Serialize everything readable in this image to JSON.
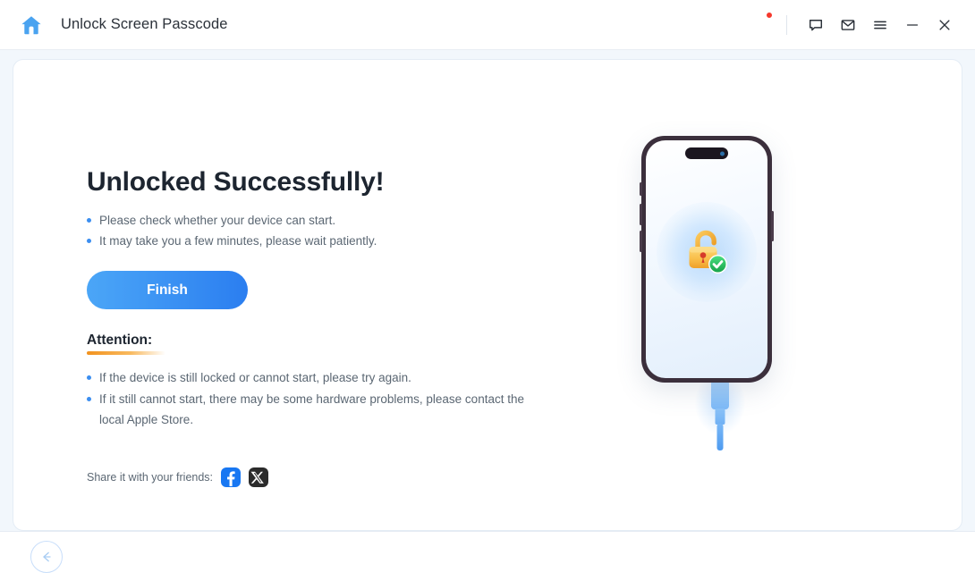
{
  "titlebar": {
    "home_icon": "home-icon",
    "title": "Unlock Screen Passcode",
    "icons": {
      "avatar": "user-avatar-icon",
      "feedback": "chat-bubble-icon",
      "mail": "envelope-icon",
      "menu": "hamburger-menu-icon",
      "minimize": "minimize-icon",
      "close": "close-icon"
    }
  },
  "main": {
    "headline": "Unlocked Successfully!",
    "notes": [
      "Please check whether your device can start.",
      "It may take you a few minutes, please wait patiently."
    ],
    "finish_label": "Finish",
    "attention": {
      "title": "Attention:",
      "items": [
        "If the device is still locked or cannot start, please try again.",
        "If it still cannot start, there may be some hardware problems, please contact the local Apple Store."
      ]
    },
    "share": {
      "label": "Share it with your friends:",
      "facebook": "facebook-icon",
      "x": "x-twitter-icon"
    },
    "illustration": {
      "device": "iphone-device",
      "status_icon": "unlocked-padlock-with-check-icon",
      "cable": "lightning-cable-icon"
    }
  },
  "bottombar": {
    "back_icon": "arrow-left-icon"
  },
  "colors": {
    "accent": "#2b7ef0",
    "accent_light": "#4ba6f7",
    "attention": "#f2921e",
    "success": "#22c55e",
    "lock": "#f5b53f",
    "notification": "#f5382c",
    "page_bg": "#f2f7fc"
  }
}
